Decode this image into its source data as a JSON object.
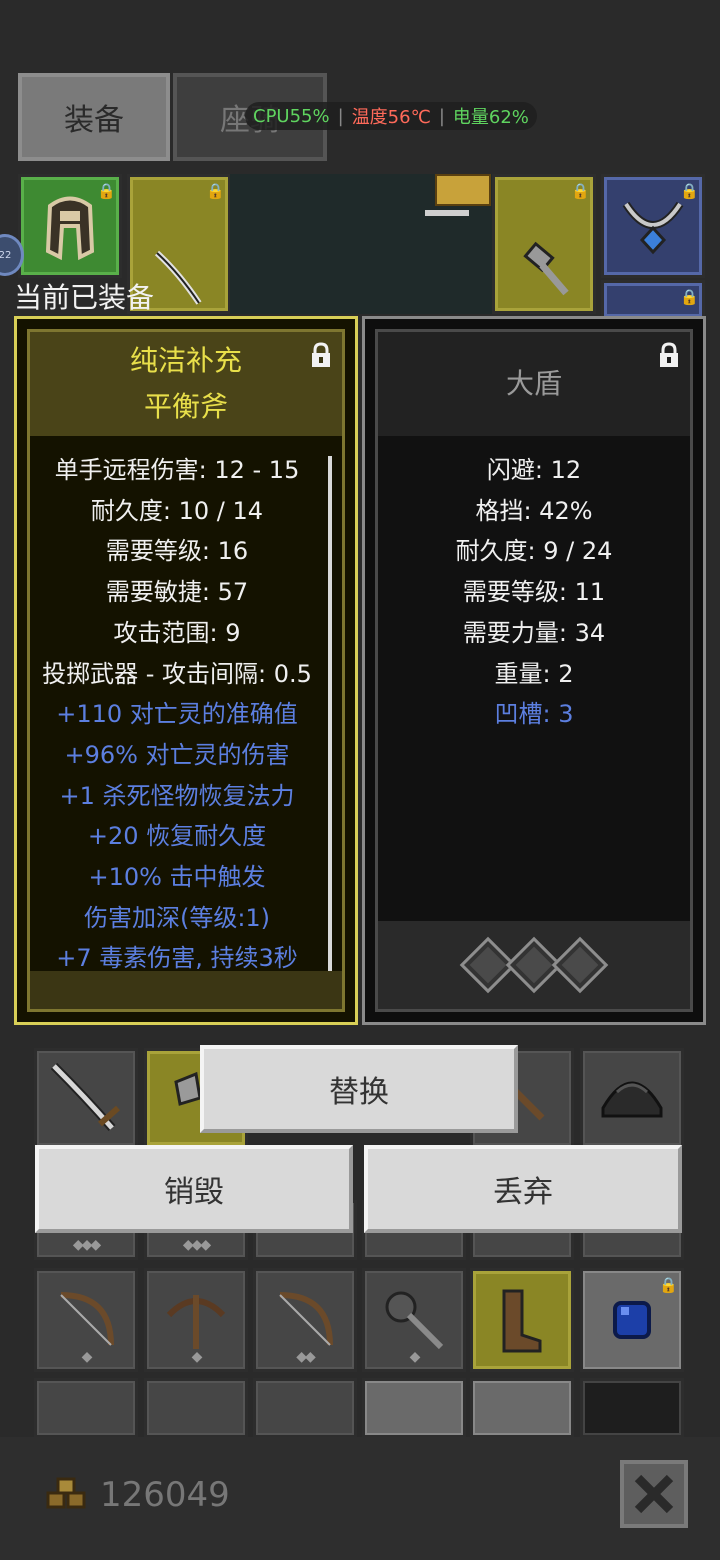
{
  "tabs": [
    {
      "label": "装备"
    },
    {
      "label": "座骑"
    }
  ],
  "status": {
    "cpu": "CPU55%",
    "temp": "温度56℃",
    "battery": "电量62%",
    "cpu_color": "#5fd45f",
    "temp_color": "#ff6a5a",
    "battery_color": "#5fd45f"
  },
  "round_badge": "22",
  "equipped_label": "当前已装备",
  "left_card": {
    "title_line1": "纯洁补充",
    "title_line2": "平衡斧",
    "stats": [
      "单手远程伤害: 12 - 15",
      "耐久度: 10 / 14",
      "需要等级: 16",
      "需要敏捷: 57",
      "攻击范围: 9",
      "投掷武器 - 攻击间隔: 0.5"
    ],
    "magic_stats": [
      "+110 对亡灵的准确值",
      "+96% 对亡灵的伤害",
      "+1 杀死怪物恢复法力",
      "+20 恢复耐久度",
      "+10% 击中触发",
      "伤害加深(等级:1)",
      "+7 毒素伤害, 持续3秒"
    ]
  },
  "right_card": {
    "title": "大盾",
    "stats": [
      "闪避: 12",
      "格挡: 42%",
      "耐久度: 9 / 24",
      "需要等级: 11",
      "需要力量: 34",
      "重量: 2"
    ],
    "magic_stats": [
      "凹槽: 3"
    ],
    "sockets": 3
  },
  "buttons": {
    "replace": "替换",
    "destroy": "销毁",
    "discard": "丢弃"
  },
  "gold": "126049",
  "colors": {
    "unique_title": "#e8df4a",
    "normal_title": "#9a9a9a",
    "magic_text": "#5c7fe0"
  }
}
